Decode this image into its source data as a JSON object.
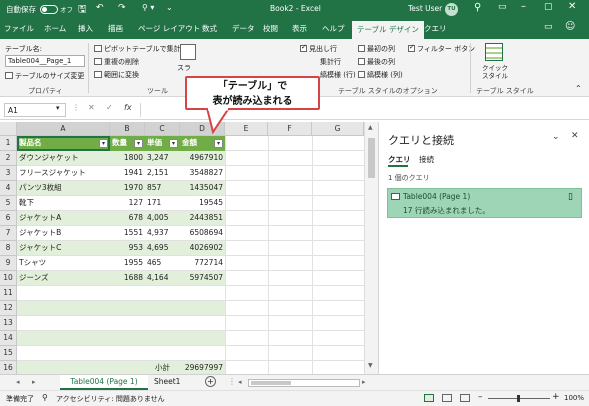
{
  "titlebar": {
    "autosave": "自動保存",
    "autosave_state": "オフ",
    "title": "Book2 - Excel",
    "user": "Test User",
    "user_initials": "TU"
  },
  "menu": [
    "ファイル",
    "ホーム",
    "挿入",
    "描画",
    "ページ レイアウト",
    "数式",
    "データ",
    "校閲",
    "表示",
    "ヘルプ",
    "テーブル デザイン",
    "クエリ"
  ],
  "ribbon": {
    "table_name_label": "テーブル名:",
    "table_name_value": "Table004__Page_1",
    "resize": "テーブルのサイズ変更",
    "group_properties": "プロパティ",
    "pivot": "ピボットテーブルで集計",
    "remove_dup": "重複の削除",
    "convert_range": "範囲に変換",
    "slicer": "スラ",
    "group_tools": "ツール",
    "header_row": "見出し行",
    "total_row": "集計行",
    "banded_rows": "縞模様 (行)",
    "first_col": "最初の列",
    "last_col": "最後の列",
    "banded_cols": "縞模様 (列)",
    "filter_btn": "フィルター ボタン",
    "group_style_options": "テーブル スタイルのオプション",
    "quick_style": "クイック スタイル",
    "group_styles": "テーブル スタイル"
  },
  "callout": {
    "line1": "「テーブル」で",
    "line2": "表が読み込まれる"
  },
  "formula": {
    "namebox": "A1",
    "fx": "fx"
  },
  "sheet": {
    "columns": [
      "A",
      "B",
      "C",
      "D",
      "E",
      "F",
      "G"
    ],
    "headers": [
      "製品名",
      "数量",
      "単価",
      "金額"
    ],
    "rows": [
      {
        "r": "2",
        "name": "ダウンジャケット",
        "qty": "1800",
        "price": "3,247",
        "amount": "4967910"
      },
      {
        "r": "3",
        "name": "フリースジャケット",
        "qty": "1941",
        "price": "2,151",
        "amount": "3548827"
      },
      {
        "r": "4",
        "name": "パンツ3枚組",
        "qty": "1970",
        "price": "857",
        "amount": "1435047"
      },
      {
        "r": "5",
        "name": "靴下",
        "qty": "127",
        "price": "171",
        "amount": "19545"
      },
      {
        "r": "6",
        "name": "ジャケットA",
        "qty": "678",
        "price": "4,005",
        "amount": "2443851"
      },
      {
        "r": "7",
        "name": "ジャケットB",
        "qty": "1551",
        "price": "4,937",
        "amount": "6508694"
      },
      {
        "r": "8",
        "name": "ジャケットC",
        "qty": "953",
        "price": "4,695",
        "amount": "4026902"
      },
      {
        "r": "9",
        "name": "Tシャツ",
        "qty": "1955",
        "price": "465",
        "amount": "772714"
      },
      {
        "r": "10",
        "name": "ジーンズ",
        "qty": "1688",
        "price": "4,164",
        "amount": "5974507"
      }
    ],
    "empty_rows": [
      "11",
      "12",
      "13",
      "14",
      "15"
    ],
    "total_row": {
      "r": "16",
      "label": "小計",
      "amount": "29697997"
    }
  },
  "panel": {
    "title": "クエリと接続",
    "tab_query": "クエリ",
    "tab_conn": "接続",
    "count": "1 個のクエリ",
    "query_name": "Table004 (Page 1)",
    "query_status": "17 行読み込まれました。"
  },
  "tabs": {
    "sheet1": "Table004 (Page 1)",
    "sheet2": "Sheet1"
  },
  "status": {
    "ready": "準備完了",
    "accessibility": "アクセシビリティ: 問題ありません",
    "zoom": "100%"
  },
  "colors": {
    "excel_green": "#217346",
    "table_header": "#70ad47",
    "band": "#e2efda",
    "query_bg": "#9fd5b7",
    "callout_border": "#d64545"
  }
}
